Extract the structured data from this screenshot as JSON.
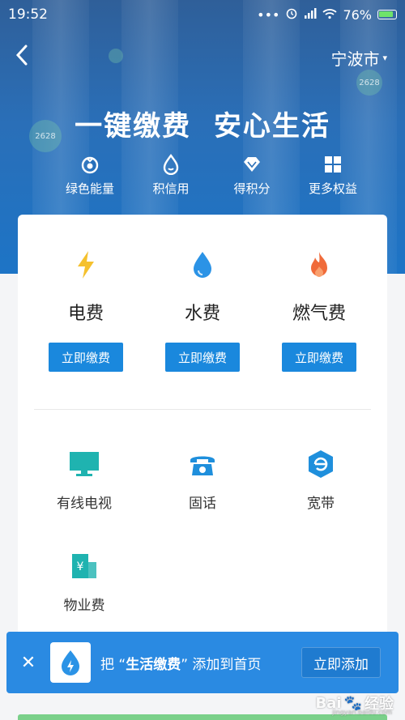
{
  "status": {
    "time": "19:52",
    "dots": "•••",
    "battery": "76%"
  },
  "nav": {
    "back": "‹",
    "city": "宁波市",
    "caret": "▾"
  },
  "hero": {
    "slogan": "一键缴费  安心生活",
    "bubble_1": "2628",
    "bubble_2": "2628"
  },
  "perks": [
    {
      "label": "绿色能量",
      "icon": "green-energy-icon"
    },
    {
      "label": "积信用",
      "icon": "credit-drop-icon"
    },
    {
      "label": "得积分",
      "icon": "points-diamond-icon"
    },
    {
      "label": "更多权益",
      "icon": "more-grid-icon"
    }
  ],
  "bills": [
    {
      "name": "电费",
      "button": "立即缴费",
      "icon": "lightning-icon",
      "color": "#f5c12e"
    },
    {
      "name": "水费",
      "button": "立即缴费",
      "icon": "water-drop-icon",
      "color": "#2b93e6"
    },
    {
      "name": "燃气费",
      "button": "立即缴费",
      "icon": "flame-icon",
      "color": "#f06b3a"
    }
  ],
  "services": [
    {
      "label": "有线电视",
      "icon": "tv-icon",
      "color": "#1fb3b0"
    },
    {
      "label": "固话",
      "icon": "telephone-icon",
      "color": "#1f8fdc"
    },
    {
      "label": "宽带",
      "icon": "broadband-icon",
      "color": "#1f8fdc"
    },
    {
      "label": "物业费",
      "icon": "property-icon",
      "color": "#1fb3b0"
    }
  ],
  "toast": {
    "close": "✕",
    "prefix": "把 “",
    "app_name": "生活缴费",
    "suffix": "” 添加到首页",
    "button": "立即添加"
  },
  "watermark": {
    "brand": "Bai",
    "paw": "🐾",
    "suffix": "经验",
    "url": "jingyan.baidu.com"
  },
  "colors": {
    "accent": "#1a88dd",
    "toast_bg": "#2a8ae2"
  }
}
